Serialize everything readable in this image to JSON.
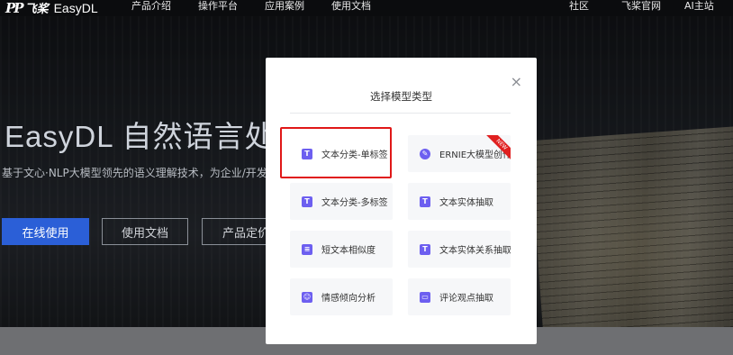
{
  "nav": {
    "logo_mark": "PP",
    "logo_text": "飞桨",
    "product": "EasyDL",
    "items": [
      "产品介绍",
      "操作平台",
      "应用案例",
      "使用文档"
    ],
    "right": [
      "社区",
      "飞桨官网",
      "AI主站"
    ]
  },
  "hero": {
    "title": "EasyDL 自然语言处",
    "subtitle": "基于文心·NLP大模型领先的语义理解技术，为企业/开发者",
    "btn_primary": "在线使用",
    "btn_docs": "使用文档",
    "btn_price": "产品定价"
  },
  "modal": {
    "title": "选择模型类型",
    "close": "×",
    "cards": [
      {
        "label": "文本分类-单标签",
        "icon": "T"
      },
      {
        "label": "ERNIE大模型创作",
        "icon": "✎",
        "badge": "NEW"
      },
      {
        "label": "文本分类-多标签",
        "icon": "T"
      },
      {
        "label": "文本实体抽取",
        "icon": "T"
      },
      {
        "label": "短文本相似度",
        "icon": "≡"
      },
      {
        "label": "文本实体关系抽取",
        "icon": "T"
      },
      {
        "label": "情感倾向分析",
        "icon": "☺"
      },
      {
        "label": "评论观点抽取",
        "icon": "▭"
      }
    ]
  },
  "colors": {
    "accent": "#6d5ff0",
    "primary_button": "#2b5fd7",
    "selection": "#e01818"
  }
}
